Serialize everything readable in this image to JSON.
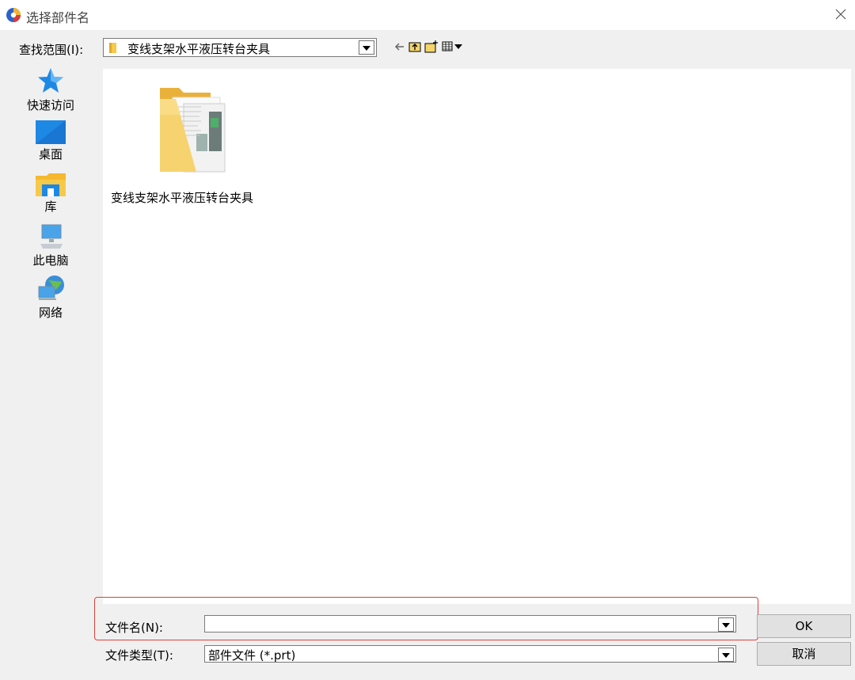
{
  "window": {
    "title": "选择部件名"
  },
  "lookin": {
    "label": "查找范围(I):",
    "value": "变线支架水平液压转台夹具"
  },
  "toolbar": [
    "back-icon",
    "up-folder-icon",
    "new-folder-icon",
    "view-menu-icon"
  ],
  "places": [
    {
      "label": "快速访问",
      "icon": "star-icon"
    },
    {
      "label": "桌面",
      "icon": "desktop-icon"
    },
    {
      "label": "库",
      "icon": "library-icon"
    },
    {
      "label": "此电脑",
      "icon": "computer-icon"
    },
    {
      "label": "网络",
      "icon": "network-icon"
    }
  ],
  "files": [
    {
      "name": "变线支架水平液压转台夹具",
      "icon": "folder-icon"
    }
  ],
  "filename": {
    "label": "文件名(N):",
    "value": ""
  },
  "filetype": {
    "label": "文件类型(T):",
    "value": "部件文件 (*.prt)"
  },
  "buttons": {
    "ok": "OK",
    "cancel": "取消"
  },
  "colors": {
    "highlight": "#e0403a",
    "folder": "#f5c94a",
    "accent": "#1e88e5"
  }
}
